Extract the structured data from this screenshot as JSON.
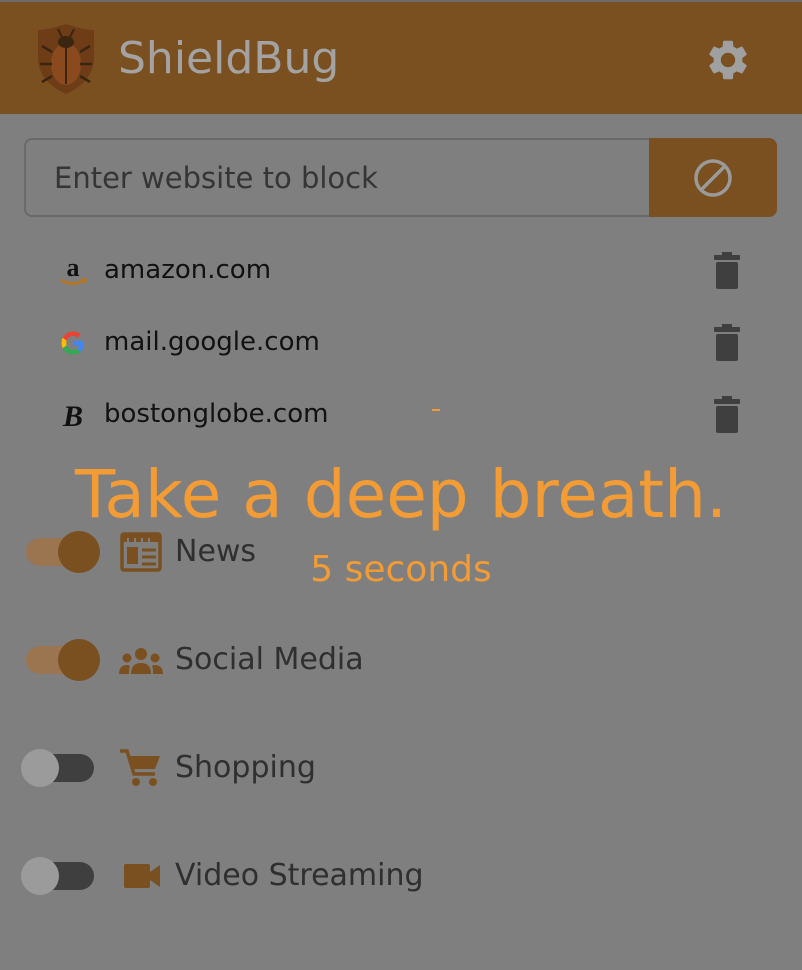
{
  "app": {
    "title": "ShieldBug"
  },
  "search": {
    "placeholder": "Enter website to block"
  },
  "blocked_sites": [
    {
      "domain": "amazon.com",
      "icon": "amazon-icon"
    },
    {
      "domain": "mail.google.com",
      "icon": "google-icon"
    },
    {
      "domain": "bostonglobe.com",
      "icon": "bostonglobe-icon"
    }
  ],
  "overlay": {
    "message": "Take a deep breath.",
    "countdown": "5 seconds"
  },
  "categories": [
    {
      "label": "News",
      "enabled": true,
      "icon": "newspaper-icon"
    },
    {
      "label": "Social Media",
      "enabled": true,
      "icon": "people-icon"
    },
    {
      "label": "Shopping",
      "enabled": false,
      "icon": "cart-icon"
    },
    {
      "label": "Video Streaming",
      "enabled": false,
      "icon": "video-camera-icon"
    }
  ],
  "colors": {
    "accent": "#7a5020",
    "overlay_text": "#f39b35",
    "dim_background": "#7f7f7f"
  }
}
